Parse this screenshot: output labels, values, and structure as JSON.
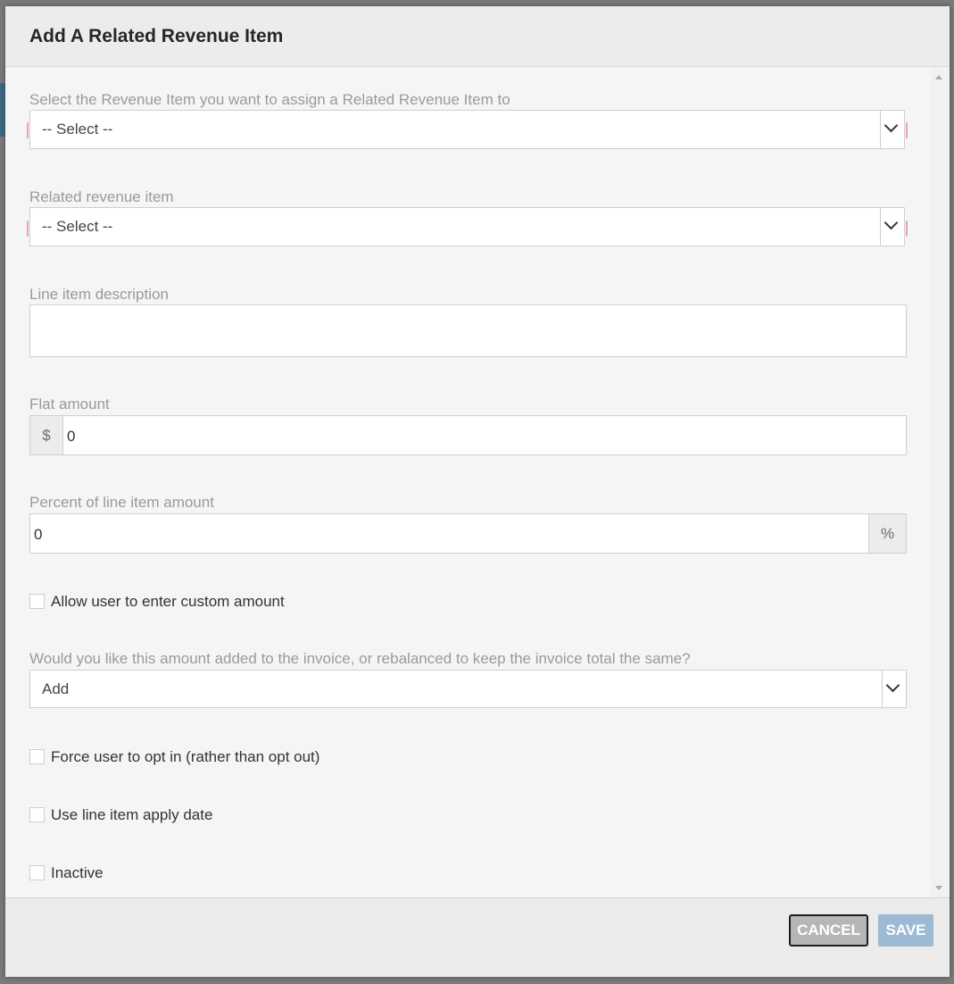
{
  "dialog": {
    "title": "Add A Related Revenue Item"
  },
  "form": {
    "revenue_item": {
      "label": "Select the Revenue Item you want to assign a Related Revenue Item to",
      "value": "-- Select --"
    },
    "related_item": {
      "label": "Related revenue item",
      "value": "-- Select --"
    },
    "description": {
      "label": "Line item description",
      "value": ""
    },
    "flat_amount": {
      "label": "Flat amount",
      "prefix": "$",
      "value": "0"
    },
    "percent": {
      "label": "Percent of line item amount",
      "value": "0",
      "suffix": "%"
    },
    "custom_amount": {
      "label": "Allow user to enter custom amount",
      "checked": false
    },
    "rebalance": {
      "label": "Would you like this amount added to the invoice, or rebalanced to keep the invoice total the same?",
      "value": "Add"
    },
    "force_opt_in": {
      "label": "Force user to opt in (rather than opt out)",
      "checked": false
    },
    "apply_date": {
      "label": "Use line item apply date",
      "checked": false
    },
    "inactive": {
      "label": "Inactive",
      "checked": false
    }
  },
  "footer": {
    "cancel_label": "CANCEL",
    "save_label": "SAVE"
  },
  "colors": {
    "required_marker": "#e8a1b4",
    "save_button": "#9cbad4",
    "cancel_button": "#b6b6b6"
  },
  "icons": {
    "dropdown": "chevron-down-icon",
    "scroll_up": "scroll-up-arrow-icon",
    "scroll_down": "scroll-down-arrow-icon"
  }
}
